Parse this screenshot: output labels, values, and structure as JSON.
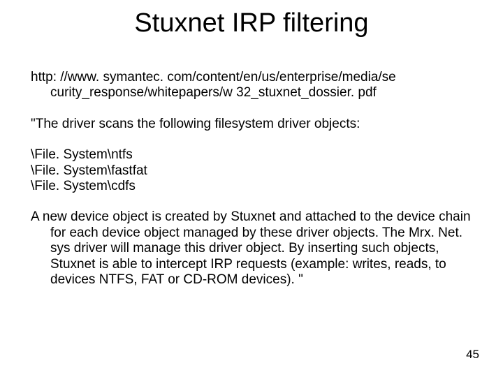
{
  "title": "Stuxnet IRP filtering",
  "url_line": "http: //www. symantec. com/content/en/us/enterprise/media/se curity_response/whitepapers/w 32_stuxnet_dossier. pdf",
  "quote_intro": "\"The driver scans the following filesystem driver objects:",
  "fs_lines": [
    "\\File. System\\ntfs",
    "\\File. System\\fastfat",
    "\\File. System\\cdfs"
  ],
  "paragraph": "A new device object is created by Stuxnet and attached to the device chain for each device object managed by these driver objects. The Mrx. Net. sys driver will manage this driver object. By inserting such objects, Stuxnet is able to intercept IRP requests (example: writes, reads, to devices NTFS, FAT or CD-ROM devices). \"",
  "page_number": "45"
}
